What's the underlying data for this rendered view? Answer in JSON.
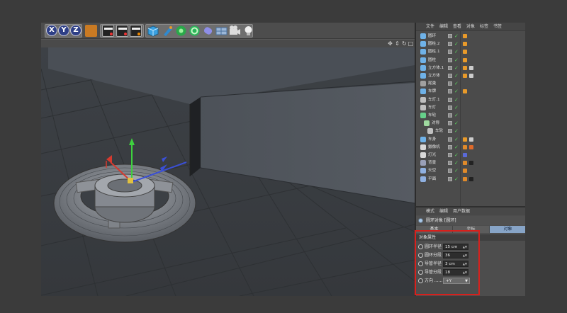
{
  "toolbar": {
    "axis_x": "X",
    "axis_y": "Y",
    "axis_z": "Z",
    "icons": [
      "axis-x-icon",
      "axis-y-icon",
      "axis-z-icon",
      "coordinate-icon",
      "clapper-icon",
      "clapper-play-icon",
      "clapper-settings-icon",
      "cube-icon",
      "pen-icon",
      "subdivision-icon",
      "array-icon",
      "deformer-icon",
      "floor-icon",
      "camera-icon",
      "light-icon"
    ]
  },
  "viewport": {
    "nav_icons": [
      "move-view-icon",
      "zoom-view-icon",
      "rotate-view-icon",
      "maximize-view-icon"
    ]
  },
  "object_manager": {
    "menu": [
      "文件",
      "编辑",
      "查看",
      "对象",
      "标签",
      "书签"
    ],
    "objects": [
      {
        "name": "圆环",
        "indent": 0
      },
      {
        "name": "圆柱.2",
        "indent": 0
      },
      {
        "name": "圆柱.1",
        "indent": 0
      },
      {
        "name": "圆柱",
        "indent": 0
      },
      {
        "name": "立方体.1",
        "indent": 0
      },
      {
        "name": "立方体",
        "indent": 0
      },
      {
        "name": "尾巢",
        "indent": 0
      },
      {
        "name": "车牌",
        "indent": 0
      },
      {
        "name": "车灯.1",
        "indent": 0
      },
      {
        "name": "车灯",
        "indent": 0
      },
      {
        "name": "车轮",
        "indent": 0
      },
      {
        "name": "对称",
        "indent": 1
      },
      {
        "name": "车轮",
        "indent": 2
      },
      {
        "name": "车身",
        "indent": 0
      },
      {
        "name": "摄像机",
        "indent": 0
      },
      {
        "name": "灯光",
        "indent": 0
      },
      {
        "name": "背景",
        "indent": 0
      },
      {
        "name": "天空",
        "indent": 0
      },
      {
        "name": "平面",
        "indent": 0
      }
    ]
  },
  "attributes": {
    "menu": [
      "模式",
      "编辑",
      "用户数据"
    ],
    "title": "圆环对象 [圆环]",
    "tabs": [
      "基本",
      "坐标",
      "对象"
    ],
    "active_tab": "对象",
    "section": "对象属性",
    "rows": [
      {
        "label": "圆环半径",
        "value": "15 cm"
      },
      {
        "label": "圆环分段",
        "value": "36"
      },
      {
        "label": "导管半径",
        "value": "3 cm"
      },
      {
        "label": "导管分段",
        "value": "18"
      },
      {
        "label": "方向 ........",
        "value": "+Y"
      }
    ]
  },
  "colors": {
    "highlight": "#d8201c",
    "active_tab": "#87a4c7",
    "axis_x": "#d63a2f",
    "axis_y": "#3ed13e",
    "axis_z": "#3a4fd6"
  }
}
